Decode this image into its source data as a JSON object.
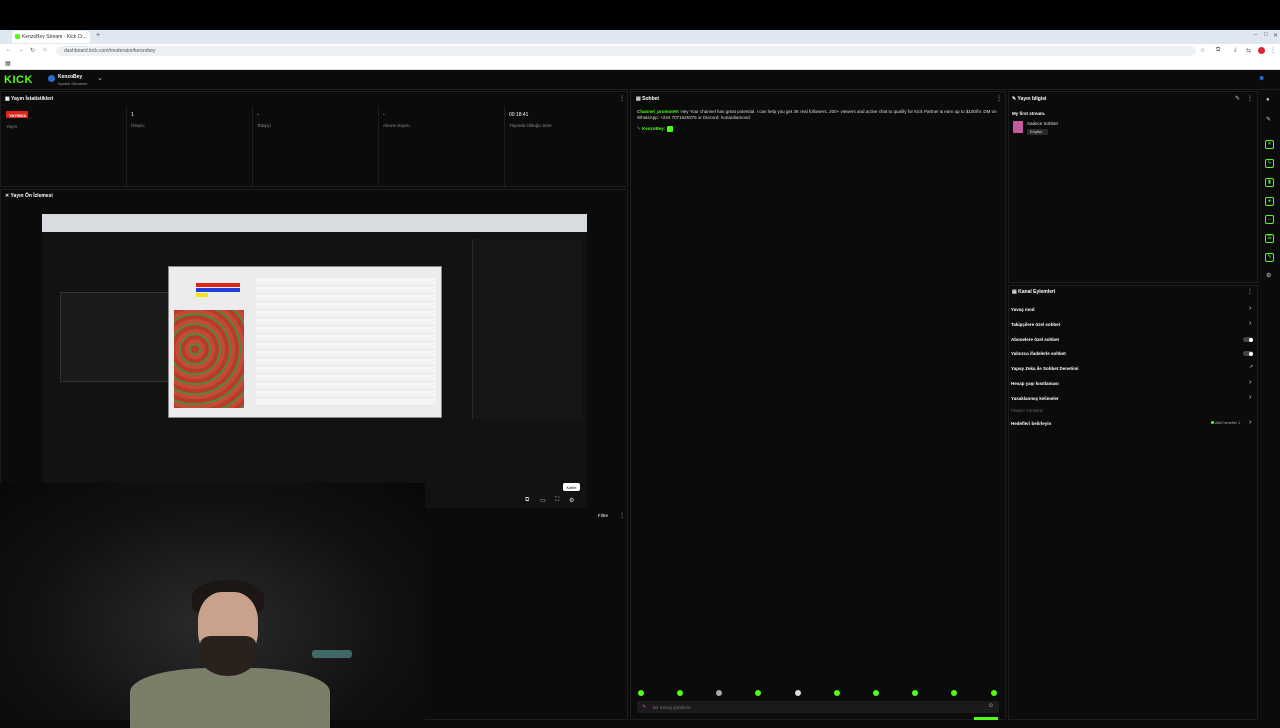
{
  "browser": {
    "tab_title": "KenzoBey Stream - Kick Cr...",
    "url": "dashboard.kick.com/moderator/kenzobey",
    "new_tab_label": "+"
  },
  "header": {
    "logo": "KICK",
    "channel_name": "KenzoBey",
    "channel_sub": "Ayarlık Streamer"
  },
  "stats": {
    "title": "Yayın İstatistikleri",
    "live_badge": "YAYINDA",
    "items": [
      {
        "value": "",
        "label": "Yayın"
      },
      {
        "value": "1",
        "label": "İzleyici"
      },
      {
        "value": "-",
        "label": "Takipçi"
      },
      {
        "value": "-",
        "label": "Abone Sayısı"
      },
      {
        "value": "00:18:41",
        "label": "Yayında Olduğu Süre"
      }
    ]
  },
  "preview": {
    "title": "Yayın Ön İzlemesi",
    "tooltip": "Kalite",
    "filter_label": "Filtre"
  },
  "chat": {
    "title": "Sohbet",
    "messages": [
      {
        "user": "Channel_promote9:",
        "text": "Hey Your channel has great potential. I can help you get 3K real followers, 200+ viewers and active chat to qualify for Kick Partner & earn up to $100/hr. DM on WhatsApp: +234 7071625375 or Discord: horiardiamond"
      },
      {
        "user": "KenzoBey:",
        "text": ""
      }
    ],
    "input_placeholder": "Bir mesaj gönderin"
  },
  "stream_info": {
    "title": "Yayın bilgisi",
    "stream_title": "My first stream.",
    "category": "Sadece Sohbet",
    "language_tag": "English"
  },
  "channel_actions": {
    "title": "Kanal Eylemleri",
    "items": [
      {
        "label": "Yavaş mod",
        "control": "arrow"
      },
      {
        "label": "Takipçilere özel sohbet",
        "control": "arrow"
      },
      {
        "label": "Abonelere özel sohbet",
        "control": "toggle"
      },
      {
        "label": "Yalnızca ifadelerle sohbet",
        "control": "toggle"
      },
      {
        "label": "Yapay Zeka ile Sohbet Denetimi",
        "control": "external"
      },
      {
        "label": "Hesap yaşı kısıtlaması",
        "control": "arrow"
      },
      {
        "label": "Yasaklanmış kelimeler",
        "control": "arrow"
      },
      {
        "label": "İzleyici Yönetimi",
        "control": "none"
      },
      {
        "label": "Hedefleri belirleyin",
        "control": "arrow"
      }
    ],
    "active_targets": "Aktif hedefler 1"
  },
  "colors": {
    "brand": "#53fc18",
    "live": "#e0241a",
    "background": "#0b0b0c"
  },
  "icons": [
    "pencil-icon",
    "kebab-menu-icon",
    "chevron-down-icon",
    "settings-gear-icon",
    "fullscreen-icon",
    "popout-icon",
    "emote-icon"
  ]
}
